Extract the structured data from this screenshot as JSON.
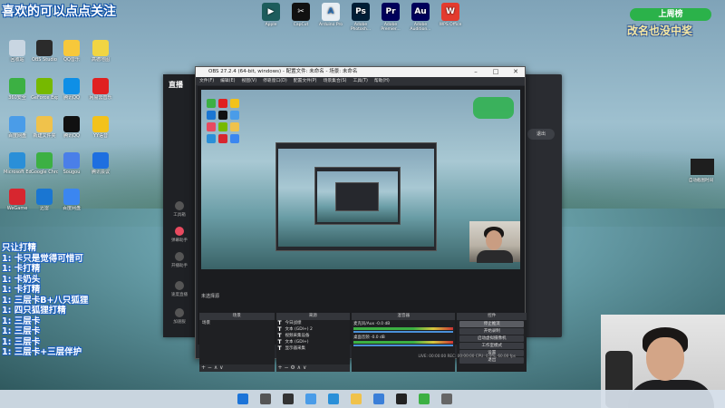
{
  "overlay": {
    "top_left_title": "喜欢的可以点点关注",
    "sign_board": "上周榜",
    "sign_sub": "改名也没中奖",
    "chat_lines": [
      "只让打精",
      "1: 卡只是觉得可惜可",
      "1: 卡打精",
      "1: 卡奶头",
      "1: 卡打精",
      "1: 三层卡B+八只狐狸",
      "1: 四只狐狸打精",
      "1: 三层卡",
      "1: 三层卡",
      "1: 三层卡",
      "1: 三层卡+三层伴护"
    ]
  },
  "top_apps": [
    {
      "label": "Apple",
      "color": "#1d5c5c",
      "glyph": "▶"
    },
    {
      "label": "CapCut",
      "color": "#111111",
      "glyph": "✂"
    },
    {
      "label": "Arduino Pro",
      "color": "#e8eef3",
      "glyph": "A"
    },
    {
      "label": "Adobe Photosh...",
      "color": "#001e36",
      "glyph": "Ps"
    },
    {
      "label": "Adobe Premier...",
      "color": "#00005b",
      "glyph": "Pr"
    },
    {
      "label": "Adobe Audition...",
      "color": "#00005b",
      "glyph": "Au"
    },
    {
      "label": "WPS Office",
      "color": "#e33b2e",
      "glyph": "W"
    }
  ],
  "desktop_icons": [
    {
      "label": "回收站",
      "color": "#c9d6e2"
    },
    {
      "label": "OBS Studio",
      "color": "#2b2b2b"
    },
    {
      "label": "QQ音乐",
      "color": "#f7c83b"
    },
    {
      "label": "高德地图",
      "color": "#f1d543"
    },
    {
      "label": "360安全",
      "color": "#3cb043"
    },
    {
      "label": "GeForce Experience",
      "color": "#76b900"
    },
    {
      "label": "腾讯QQ",
      "color": "#0e8fe6"
    },
    {
      "label": "网易云音乐",
      "color": "#e02020"
    },
    {
      "label": "百度网盘",
      "color": "#4a9ce8"
    },
    {
      "label": "新建文件夹",
      "color": "#f0c24b"
    },
    {
      "label": "腾讯QQ",
      "color": "#111"
    },
    {
      "label": "YY语音",
      "color": "#f3c21a"
    },
    {
      "label": "Microsoft Edge",
      "color": "#2a8fd8"
    },
    {
      "label": "Google Chrome",
      "color": "#3cb043"
    },
    {
      "label": "Sougou",
      "color": "#4a7fe8"
    },
    {
      "label": "腾讯会议",
      "color": "#1e6fe0"
    },
    {
      "label": "WeGame",
      "color": "#d7262f"
    },
    {
      "label": "迅雷",
      "color": "#1a76d2"
    },
    {
      "label": "百度网盘",
      "color": "#3b86f0"
    }
  ],
  "obs": {
    "title": "OBS 27.2.4 (64-bit, windows) - 配置文件: 未命名 - 场景: 未命名",
    "menu": [
      "文件(F)",
      "编辑(E)",
      "视图(V)",
      "停靠窗口(D)",
      "配置文件(P)",
      "场景集合(S)",
      "工具(T)",
      "帮助(H)"
    ],
    "scene_info": "未选择源",
    "panels": {
      "scenes": "场景",
      "sources": "来源",
      "mixer": "混音器",
      "transitions": "转场",
      "controls": "控件"
    },
    "scene_items": [
      "场景"
    ],
    "sources": [
      "今日战绩",
      "文本 (GDI+) 2",
      "视频采集设备",
      "文本 (GDI+)",
      "显示器采集"
    ],
    "mixer_rows": [
      {
        "name": "麦克风/Aux",
        "db": "-0.0 dB"
      },
      {
        "name": "桌面音频",
        "db": "-0.0 dB"
      }
    ],
    "controls": [
      "停止推流",
      "开始录制",
      "启动虚拟摄像机",
      "工作室模式",
      "设置",
      "退出"
    ],
    "status": "LIVE: 00:00:00   REC: 00:00:00   CPU: 0.9%, 60.00 fps"
  },
  "stream_app": {
    "logo": "直播",
    "side_items": [
      "工具箱",
      "弹幕助手",
      "开播助手",
      "速度直播",
      "加速服"
    ],
    "exit_button": "退出"
  },
  "right_widget_label": "自动截图时间",
  "taskbar": {
    "icons": [
      "windows-start",
      "search",
      "task-view",
      "widgets",
      "edge",
      "explorer",
      "store",
      "obs",
      "chrome",
      "settings"
    ]
  }
}
